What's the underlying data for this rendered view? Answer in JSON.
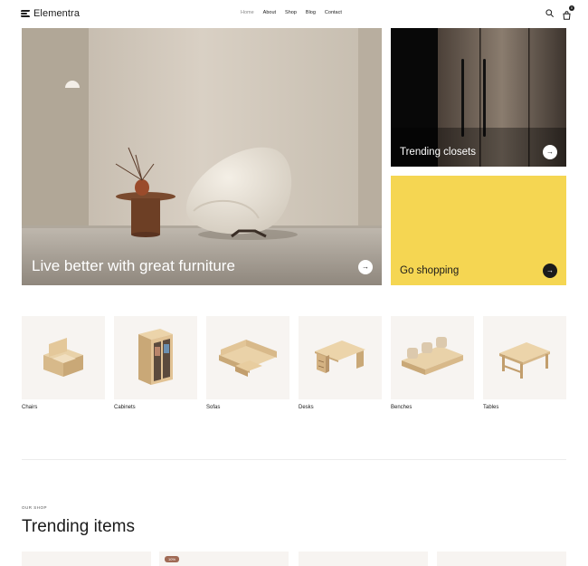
{
  "header": {
    "brand": "Elementra",
    "nav": [
      {
        "label": "Home",
        "active": true
      },
      {
        "label": "About"
      },
      {
        "label": "Shop"
      },
      {
        "label": "Blog"
      },
      {
        "label": "Contact"
      }
    ],
    "cart_count": "0",
    "icons": [
      "search-icon",
      "cart-icon"
    ]
  },
  "hero": {
    "title": "Live better with great furniture",
    "button_icon": "arrow-right-icon"
  },
  "promo_closets": {
    "title": "Trending closets",
    "button_icon": "arrow-right-icon"
  },
  "promo_shop": {
    "title": "Go shopping",
    "button_icon": "arrow-right-icon",
    "background": "#f5d652"
  },
  "categories": [
    {
      "label": "Chairs",
      "icon": "chair-icon"
    },
    {
      "label": "Cabinets",
      "icon": "cabinet-icon"
    },
    {
      "label": "Sofas",
      "icon": "sofa-icon"
    },
    {
      "label": "Desks",
      "icon": "desk-icon"
    },
    {
      "label": "Benches",
      "icon": "bench-icon"
    },
    {
      "label": "Tables",
      "icon": "table-icon"
    }
  ],
  "trending": {
    "overline": "OUR SHOP",
    "title": "Trending items",
    "products": [
      {
        "badge": ""
      },
      {
        "badge": "10%"
      },
      {
        "badge": ""
      },
      {
        "badge": ""
      }
    ]
  }
}
